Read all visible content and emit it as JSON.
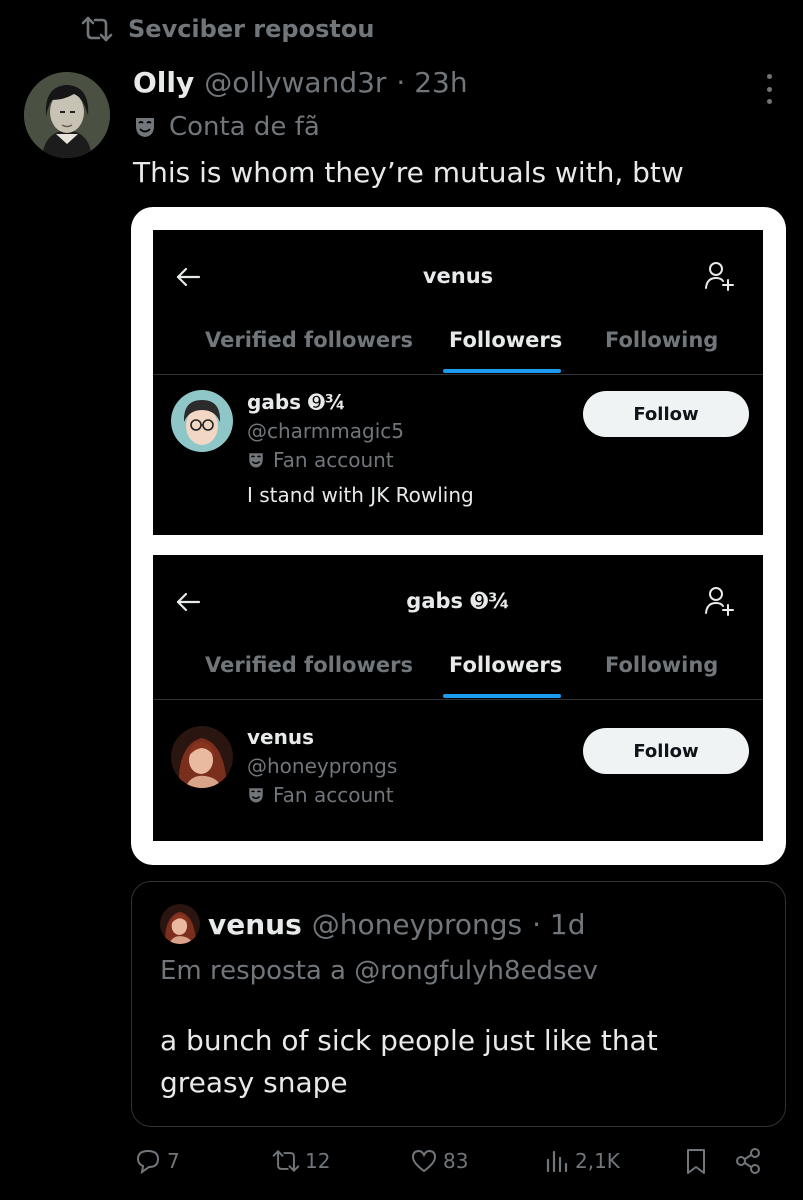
{
  "repost": {
    "text": "Sevciber repostou"
  },
  "author": {
    "name": "Olly",
    "handle": "@ollywand3r",
    "time": "· 23h",
    "badge_label": "Conta de fã"
  },
  "tweet": {
    "text": "This is whom they’re mutuals with, btw"
  },
  "screenshot_panels": [
    {
      "title": "venus",
      "tabs": [
        "Verified followers",
        "Followers",
        "Following"
      ],
      "active_tab": "Followers",
      "user": {
        "name": "gabs ➒¾",
        "handle": "@charmmagic5",
        "badge_label": "Fan account",
        "bio": "I stand with JK Rowling",
        "follow_label": "Follow"
      }
    },
    {
      "title": "gabs ➒¾",
      "tabs": [
        "Verified followers",
        "Followers",
        "Following"
      ],
      "active_tab": "Followers",
      "user": {
        "name": "venus",
        "handle": "@honeyprongs",
        "badge_label": "Fan account",
        "follow_label": "Follow"
      }
    }
  ],
  "quote": {
    "name": "venus",
    "handle": "@honeyprongs",
    "time": "· 1d",
    "reply_to": "Em resposta a @rongfulyh8edsev",
    "text": "a bunch of sick people just like that greasy snape"
  },
  "actions": {
    "replies": "7",
    "reposts": "12",
    "likes": "83",
    "views": "2,1K"
  },
  "icons": [
    "repost-icon",
    "more-icon",
    "mask-icon",
    "back-arrow-icon",
    "add-user-icon",
    "reply-icon",
    "like-icon",
    "views-icon",
    "bookmark-icon",
    "share-icon"
  ],
  "colors": {
    "background": "#000000",
    "text": "#e7e9ea",
    "muted": "#71767b",
    "accent": "#1d9bf0"
  }
}
